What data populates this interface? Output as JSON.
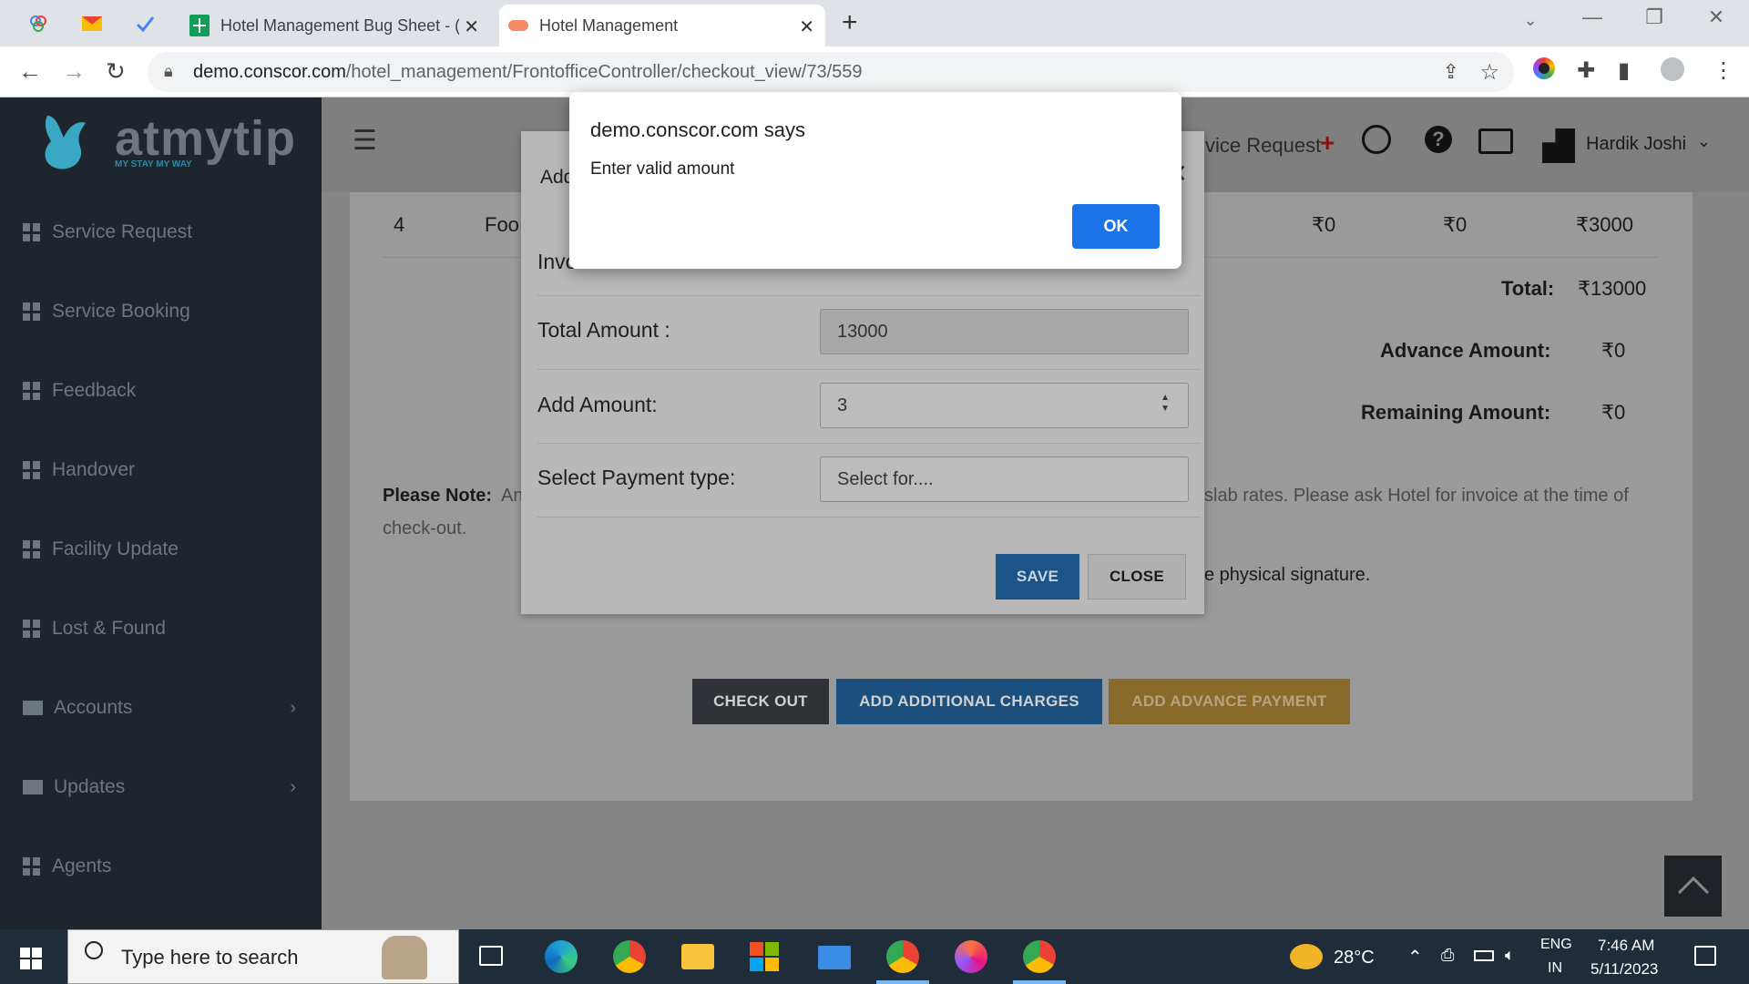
{
  "browser": {
    "tabs": [
      {
        "title": "Hotel Management Bug Sheet - (",
        "active": false
      },
      {
        "title": "Hotel Management",
        "active": true
      }
    ],
    "url_host": "demo.conscor.com",
    "url_path": "/hotel_management/FrontofficeController/checkout_view/73/559"
  },
  "app": {
    "logo_text": "atmytip",
    "logo_tagline": "MY STAY MY WAY",
    "sidebar": [
      {
        "label": "Service Request",
        "icon": "grid-icon"
      },
      {
        "label": "Service Booking",
        "icon": "grid-icon"
      },
      {
        "label": "Feedback",
        "icon": "grid-icon"
      },
      {
        "label": "Handover",
        "icon": "grid-icon"
      },
      {
        "label": "Facility Update",
        "icon": "grid-icon"
      },
      {
        "label": "Lost & Found",
        "icon": "grid-icon"
      },
      {
        "label": "Accounts",
        "icon": "mail-icon"
      },
      {
        "label": "Updates",
        "icon": "mail-icon"
      },
      {
        "label": "Agents",
        "icon": "grid-icon"
      }
    ],
    "topbar": {
      "service_request": "vice Request",
      "user_name": "Hardik Joshi"
    },
    "table_row": {
      "num": "4",
      "desc": "Foo",
      "c1": "₹0",
      "c2": "₹0",
      "c3": "₹3000"
    },
    "totals": {
      "total_label": "Total:",
      "total_value": "₹13000",
      "advance_label": "Advance Amount:",
      "advance_value": "₹0",
      "remaining_label": "Remaining Amount:",
      "remaining_value": "₹0"
    },
    "note_label": "Please Note:",
    "note_start": "An",
    "note_end": "slab rates. Please ask Hotel for invoice at the time of",
    "note_line2": "check-out.",
    "signature_text": "e physical signature.",
    "buttons": {
      "checkout": "CHECK OUT",
      "additional": "ADD ADDITIONAL CHARGES",
      "advance": "ADD ADVANCE PAYMENT"
    }
  },
  "modal": {
    "title_partial": "Add",
    "invoice_partial": "Invo",
    "total_amount_label": "Total Amount :",
    "total_amount_value": "13000",
    "add_amount_label": "Add Amount:",
    "add_amount_value": "3",
    "payment_type_label": "Select Payment type:",
    "payment_type_value": "Select for....",
    "save_label": "SAVE",
    "close_label": "CLOSE"
  },
  "alert": {
    "title": "demo.conscor.com says",
    "message": "Enter valid amount",
    "ok_label": "OK"
  },
  "taskbar": {
    "search_placeholder": "Type here to search",
    "weather": "28°C",
    "lang1": "ENG",
    "lang2": "IN",
    "time": "7:46 AM",
    "date": "5/11/2023"
  }
}
